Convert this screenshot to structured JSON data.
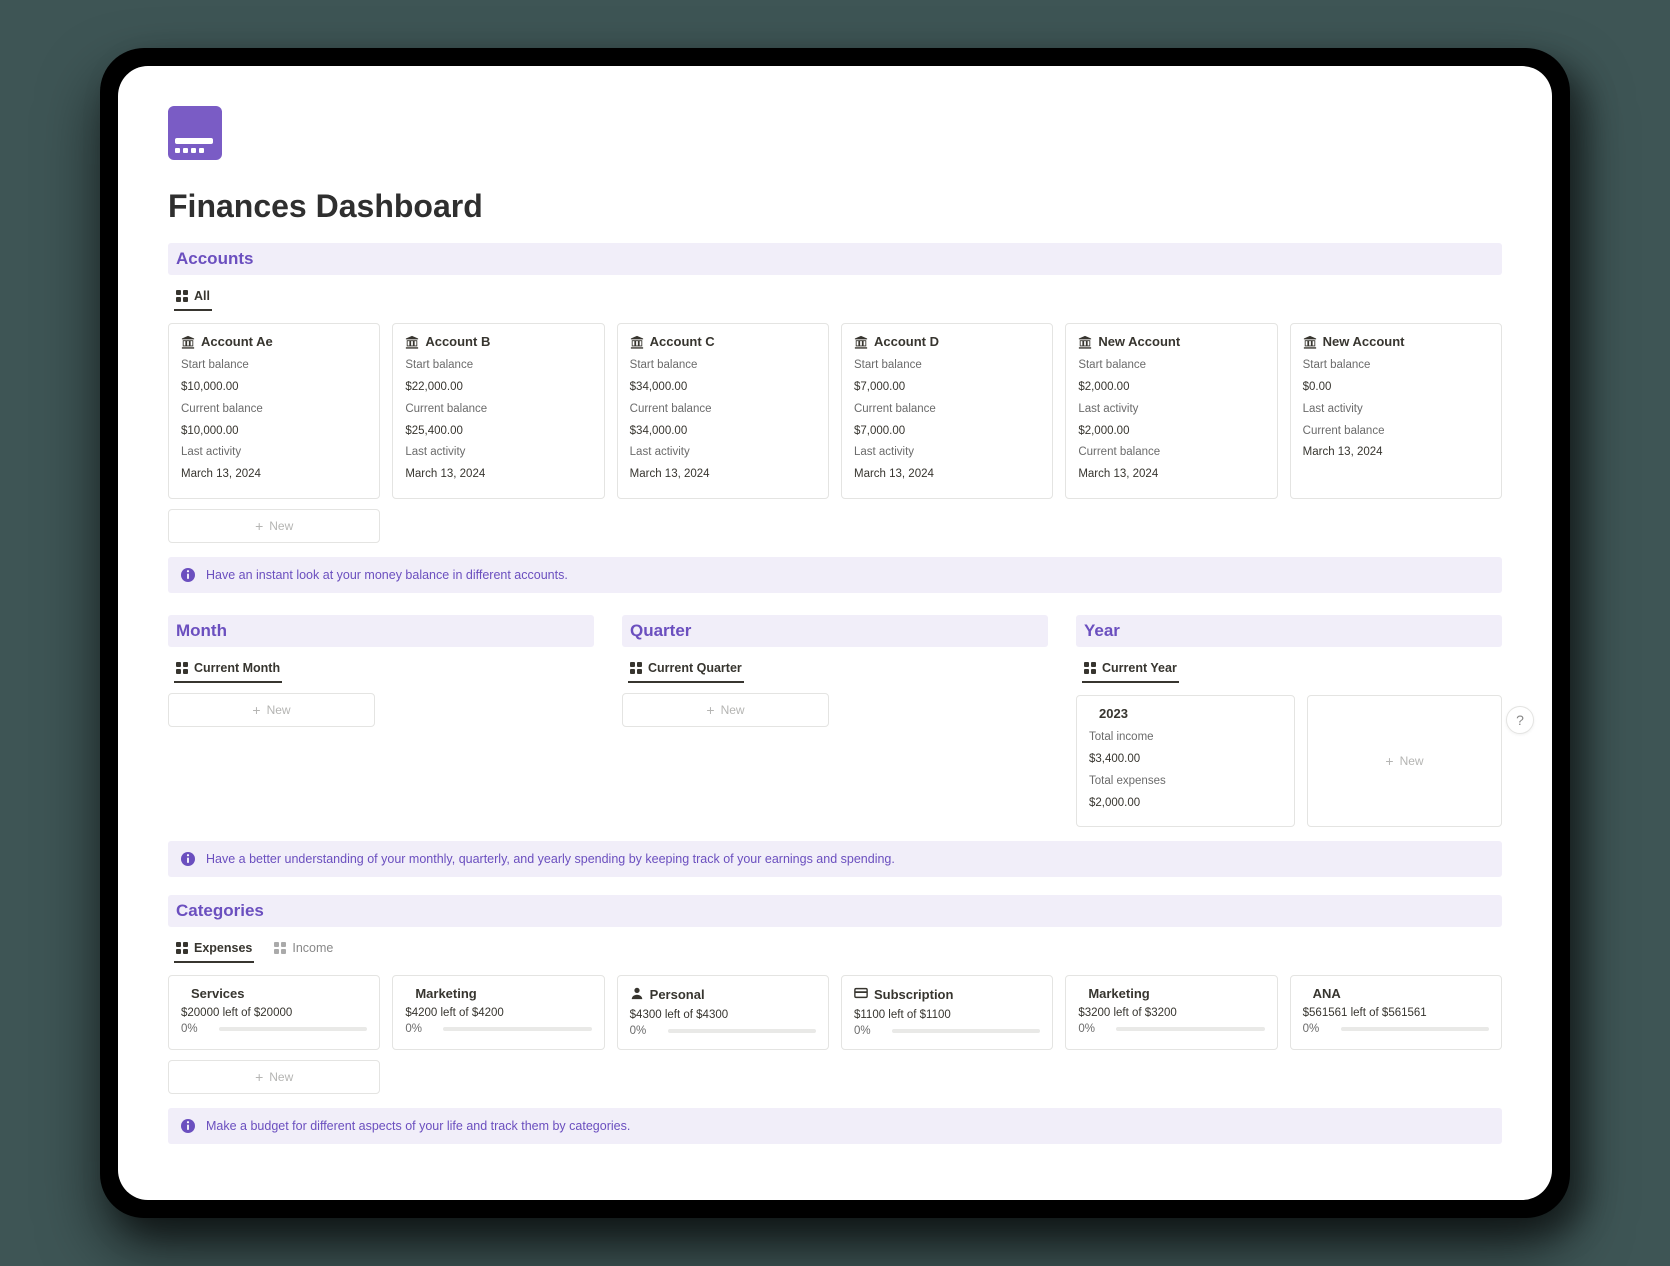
{
  "page": {
    "title": "Finances Dashboard"
  },
  "new_label": "New",
  "help_label": "?",
  "accounts": {
    "title": "Accounts",
    "tab_all": "All",
    "labels": {
      "start_balance": "Start balance",
      "current_balance": "Current balance",
      "last_activity": "Last activity"
    },
    "cards": [
      {
        "name": "Account Ae",
        "start": "$10,000.00",
        "current": "$10,000.00",
        "last": "March 13, 2024",
        "order": [
          "start",
          "current",
          "last"
        ]
      },
      {
        "name": "Account B",
        "start": "$22,000.00",
        "current": "$25,400.00",
        "last": "March 13, 2024",
        "order": [
          "start",
          "current",
          "last"
        ]
      },
      {
        "name": "Account C",
        "start": "$34,000.00",
        "current": "$34,000.00",
        "last": "March 13, 2024",
        "order": [
          "start",
          "current",
          "last"
        ]
      },
      {
        "name": "Account D",
        "start": "$7,000.00",
        "current": "$7,000.00",
        "last": "March 13, 2024",
        "order": [
          "start",
          "current",
          "last"
        ]
      },
      {
        "name": "New Account",
        "start": "$2,000.00",
        "current": "$2,000.00",
        "last": "March 13, 2024",
        "order": [
          "start",
          "last",
          "current"
        ]
      },
      {
        "name": "New Account",
        "start": "$0.00",
        "current": "March 13, 2024",
        "last": "",
        "order": [
          "start",
          "last_as_value",
          "current_label_only"
        ],
        "rows": [
          {
            "label": "Start balance",
            "value": "$0.00"
          },
          {
            "label": "Last activity",
            "value": ""
          },
          {
            "label": "Current balance",
            "value": ""
          },
          {
            "label": "",
            "value": "March 13, 2024"
          }
        ]
      }
    ],
    "callout": "Have an instant look at your money balance in different accounts."
  },
  "month": {
    "title": "Month",
    "tab": "Current Month"
  },
  "quarter": {
    "title": "Quarter",
    "tab": "Current Quarter"
  },
  "year": {
    "title": "Year",
    "tab": "Current Year",
    "card": {
      "title": "2023",
      "labels": {
        "income": "Total income",
        "expenses": "Total expenses"
      },
      "income": "$3,400.00",
      "expenses": "$2,000.00"
    }
  },
  "period_callout": "Have a better understanding of your monthly, quarterly, and yearly spending by keeping track of your earnings and spending.",
  "categories": {
    "title": "Categories",
    "tab_expenses": "Expenses",
    "tab_income": "Income",
    "cards": [
      {
        "name": "Services",
        "sub": "$20000 left of $20000",
        "pct": "0%",
        "icon": null
      },
      {
        "name": "Marketing",
        "sub": "$4200 left of $4200",
        "pct": "0%",
        "icon": null
      },
      {
        "name": "Personal",
        "sub": "$4300 left of $4300",
        "pct": "0%",
        "icon": "person"
      },
      {
        "name": "Subscription",
        "sub": "$1100 left of $1100",
        "pct": "0%",
        "icon": "card"
      },
      {
        "name": "Marketing",
        "sub": "$3200 left of $3200",
        "pct": "0%",
        "icon": null
      },
      {
        "name": "ANA",
        "sub": "$561561 left of $561561",
        "pct": "0%",
        "icon": null
      }
    ],
    "callout": "Make a budget for different aspects of your life and track them by categories."
  }
}
